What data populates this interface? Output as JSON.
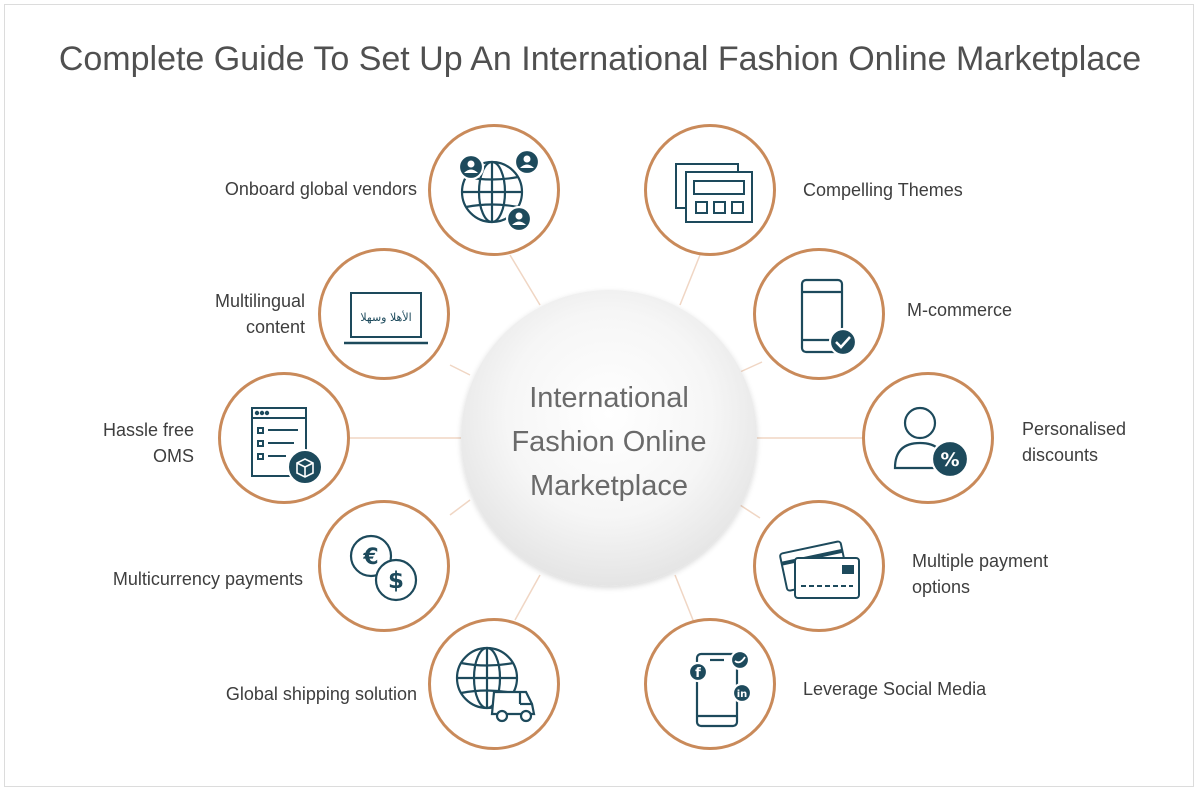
{
  "title": "Complete Guide To Set Up An International Fashion Online Marketplace",
  "center": {
    "label": "International\nFashion Online\nMarketplace"
  },
  "colors": {
    "accent_ring": "#c98a5a",
    "icon": "#1d4a5c",
    "spoke": "#f0d6c4",
    "text": "#3e3e3e"
  },
  "left_items": [
    {
      "label": "Onboard global vendors",
      "icon": "globe-users-icon"
    },
    {
      "label": "Multilingual\ncontent",
      "icon": "laptop-arabic-icon",
      "icon_text": "الأهلا وسهلا"
    },
    {
      "label": "Hassle free\nOMS",
      "icon": "oms-list-icon"
    },
    {
      "label": "Multicurrency payments",
      "icon": "currency-coins-icon"
    },
    {
      "label": "Global shipping solution",
      "icon": "globe-truck-icon"
    }
  ],
  "right_items": [
    {
      "label": "Compelling Themes",
      "icon": "themes-windows-icon"
    },
    {
      "label": "M-commerce",
      "icon": "phone-check-icon"
    },
    {
      "label": "Personalised\ndiscounts",
      "icon": "user-percent-icon"
    },
    {
      "label": "Multiple payment\noptions",
      "icon": "credit-cards-icon"
    },
    {
      "label": "Leverage Social Media",
      "icon": "phone-social-icon"
    }
  ]
}
